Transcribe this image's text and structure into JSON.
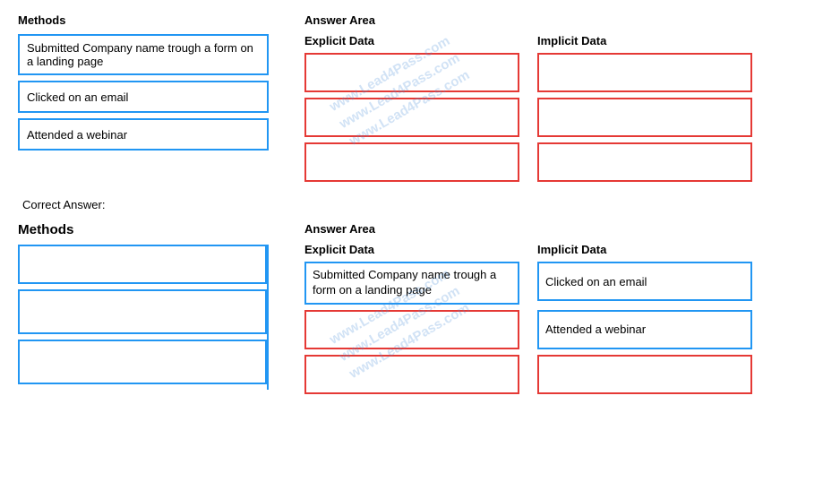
{
  "top": {
    "methods_label": "Methods",
    "answer_area_label": "Answer Area",
    "explicit_data_label": "Explicit Data",
    "implicit_data_label": "Implicit Data",
    "methods": [
      {
        "text": "Submitted Company name trough a form on a landing page"
      },
      {
        "text": "Clicked on an email"
      },
      {
        "text": "Attended a webinar"
      }
    ]
  },
  "correct": {
    "label": "Correct Answer:",
    "methods_label": "Methods",
    "answer_area_label": "Answer Area",
    "explicit_data_label": "Explicit Data",
    "implicit_data_label": "Implicit Data",
    "explicit_rows": [
      {
        "text": "Submitted Company name trough a form on a landing page"
      },
      {
        "text": ""
      },
      {
        "text": ""
      }
    ],
    "implicit_rows": [
      {
        "text": "Clicked on an email"
      },
      {
        "text": "Attended a webinar"
      },
      {
        "text": ""
      }
    ]
  },
  "watermark": {
    "line1": "www.Lead4Pass.com",
    "line2": "www.Lead4Pass.com"
  }
}
